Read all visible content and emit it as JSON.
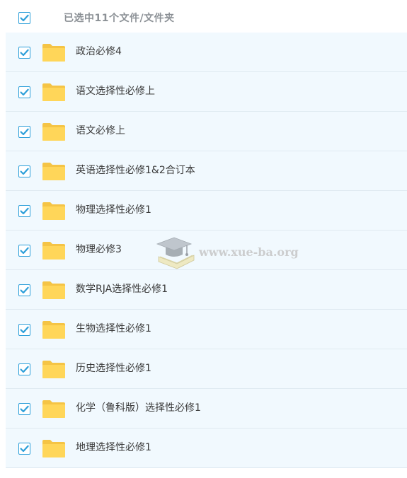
{
  "header": {
    "select_all_checked": true,
    "selected_label": "已选中11个文件/文件夹"
  },
  "colors": {
    "checkbox_accent": "#2d9fd9",
    "folder": "#ffd659",
    "row_background": "#f1f9fe"
  },
  "files": [
    {
      "name": "政治必修4",
      "checked": true,
      "icon": "folder-icon"
    },
    {
      "name": "语文选择性必修上",
      "checked": true,
      "icon": "folder-icon"
    },
    {
      "name": "语文必修上",
      "checked": true,
      "icon": "folder-icon"
    },
    {
      "name": "英语选择性必修1&2合订本",
      "checked": true,
      "icon": "folder-icon"
    },
    {
      "name": "物理选择性必修1",
      "checked": true,
      "icon": "folder-icon"
    },
    {
      "name": "物理必修3",
      "checked": true,
      "icon": "folder-icon"
    },
    {
      "name": "数学RJA选择性必修1",
      "checked": true,
      "icon": "folder-icon"
    },
    {
      "name": "生物选择性必修1",
      "checked": true,
      "icon": "folder-icon"
    },
    {
      "name": "历史选择性必修1",
      "checked": true,
      "icon": "folder-icon"
    },
    {
      "name": "化学（鲁科版）选择性必修1",
      "checked": true,
      "icon": "folder-icon"
    },
    {
      "name": "地理选择性必修1",
      "checked": true,
      "icon": "folder-icon"
    }
  ],
  "watermark": {
    "text": "www.xue-ba.org",
    "icon": "graduation-cap-book-icon"
  }
}
